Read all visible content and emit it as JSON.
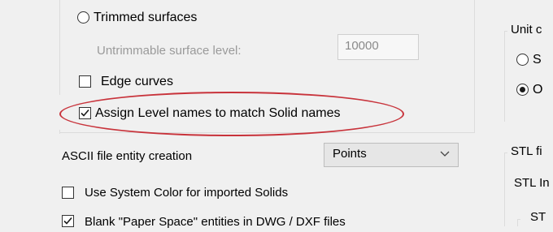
{
  "left_panel": {
    "trimmed_surfaces": {
      "label": "Trimmed surfaces",
      "checked": false
    },
    "untrimmable_level": {
      "label": "Untrimmable surface level:",
      "value": "10000"
    },
    "edge_curves": {
      "label": "Edge curves",
      "checked": false
    },
    "assign_level_names": {
      "label": "Assign Level names to match Solid names",
      "checked": true
    },
    "ascii_entity": {
      "label": "ASCII file entity creation",
      "selected": "Points"
    },
    "use_system_color": {
      "label": "Use System Color for imported Solids",
      "checked": false
    },
    "blank_paper_space": {
      "label": "Blank \"Paper Space\" entities in DWG / DXF files",
      "checked": true
    }
  },
  "right_panel": {
    "unit_group_title": "Unit c",
    "unit_option_1": {
      "label": "S",
      "checked": false
    },
    "unit_option_2": {
      "label": "O",
      "checked": true
    },
    "stl_file_title": "STL fi",
    "stl_in_label": "STL In",
    "stl_sub_label": "ST"
  },
  "colors": {
    "highlight": "#c8333b",
    "background": "#f0f0f0"
  }
}
